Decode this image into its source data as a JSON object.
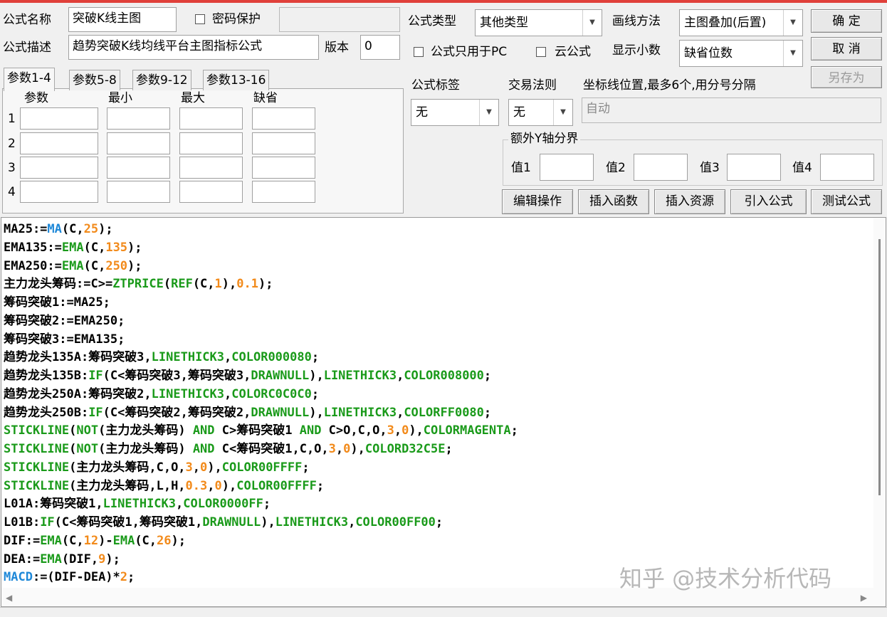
{
  "form": {
    "name_label": "公式名称",
    "name_value": "突破K线主图",
    "password_label": "密码保护",
    "desc_label": "公式描述",
    "desc_value": "趋势突破K线均线平台主图指标公式",
    "version_label": "版本",
    "version_value": "0",
    "type_label": "公式类型",
    "type_value": "其他类型",
    "draw_label": "画线方法",
    "draw_value": "主图叠加(后置)",
    "pc_only_label": "公式只用于PC",
    "cloud_label": "云公式",
    "decimal_label": "显示小数",
    "decimal_value": "缺省位数",
    "tag_label": "公式标签",
    "tag_value": "无",
    "rule_label": "交易法则",
    "rule_value": "无",
    "coord_label": "坐标线位置,最多6个,用分号分隔",
    "coord_value": "自动",
    "extra_y_label": "额外Y轴分界",
    "values": [
      "值1",
      "值2",
      "值3",
      "值4"
    ]
  },
  "buttons": {
    "ok": "确  定",
    "cancel": "取  消",
    "save_as": "另存为",
    "edit_ops": "编辑操作",
    "insert_func": "插入函数",
    "insert_res": "插入资源",
    "import_formula": "引入公式",
    "test_formula": "测试公式"
  },
  "tabs": [
    "参数1-4",
    "参数5-8",
    "参数9-12",
    "参数13-16"
  ],
  "param_headers": [
    "参数",
    "最小",
    "最大",
    "缺省"
  ],
  "param_rows": [
    "1",
    "2",
    "3",
    "4"
  ],
  "code_lines": [
    "MA25:=MA(C,25);",
    "EMA135:=EMA(C,135);",
    "EMA250:=EMA(C,250);",
    "主力龙头筹码:=C>=ZTPRICE(REF(C,1),0.1);",
    "筹码突破1:=MA25;",
    "筹码突破2:=EMA250;",
    "筹码突破3:=EMA135;",
    "趋势龙头135A:筹码突破3,LINETHICK3,COLOR000080;",
    "趋势龙头135B:IF(C<筹码突破3,筹码突破3,DRAWNULL),LINETHICK3,COLOR008000;",
    "趋势龙头250A:筹码突破2,LINETHICK3,COLORC0C0C0;",
    "趋势龙头250B:IF(C<筹码突破2,筹码突破2,DRAWNULL),LINETHICK3,COLORFF0080;",
    "STICKLINE(NOT(主力龙头筹码) AND C>筹码突破1 AND C>O,C,O,3,0),COLORMAGENTA;",
    "STICKLINE(NOT(主力龙头筹码) AND C<筹码突破1,C,O,3,0),COLORD32C5E;",
    "STICKLINE(主力龙头筹码,C,O,3,0),COLOR00FFFF;",
    "STICKLINE(主力龙头筹码,L,H,0.3,0),COLOR00FFFF;",
    "L01A:筹码突破1,LINETHICK3,COLOR0000FF;",
    "L01B:IF(C<筹码突破1,筹码突破1,DRAWNULL),LINETHICK3,COLOR00FF00;",
    "DIF:=EMA(C,12)-EMA(C,26);",
    "DEA:=EMA(DIF,9);",
    "MACD:=(DIF-DEA)*2;"
  ],
  "code_colors": {
    "default": "#000000",
    "function": "#1a9a1a",
    "ma_function": "#1e88d8",
    "number": "#f28a1a"
  },
  "watermark": "知乎 @技术分析代码"
}
